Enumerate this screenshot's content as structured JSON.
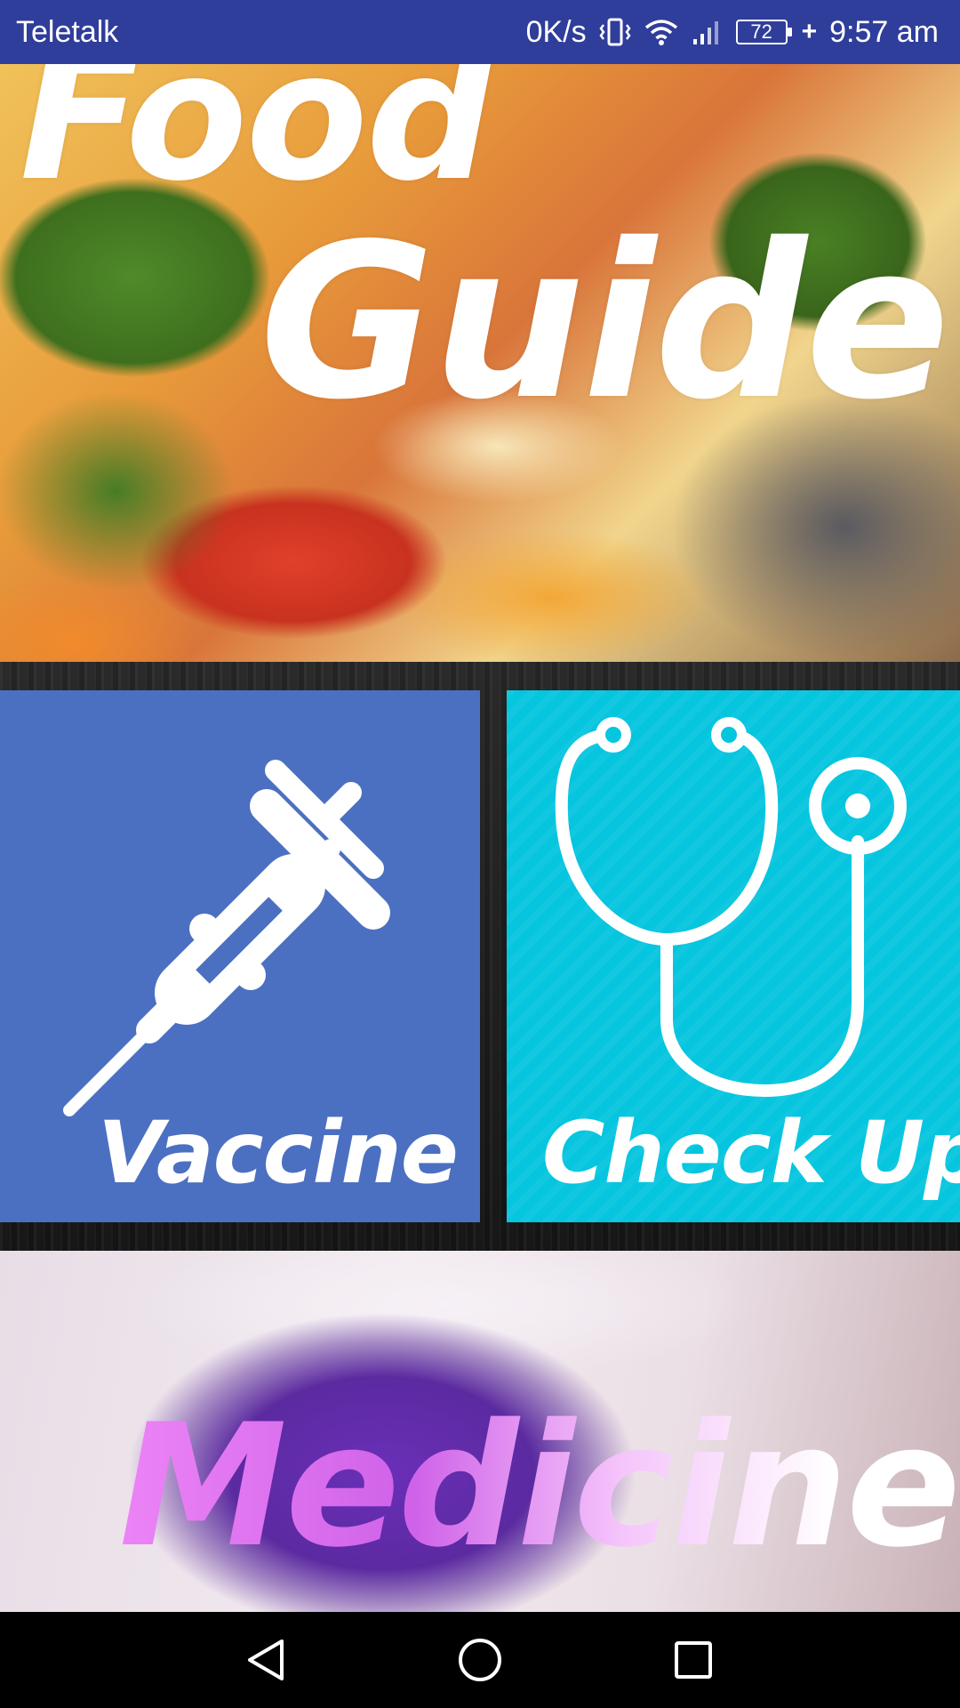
{
  "status_bar": {
    "carrier": "Teletalk",
    "net_speed": "0K/s",
    "battery_level": "72",
    "time": "9:57 am",
    "icons": [
      "vibrate-icon",
      "wifi-icon",
      "signal-icon",
      "battery-icon",
      "charging-icon"
    ]
  },
  "banner": {
    "title_line1": "Food",
    "title_line2": "Guide"
  },
  "tiles": {
    "vaccine": {
      "label": "Vaccine",
      "icon": "syringe-icon",
      "color": "#4b70c1"
    },
    "checkup": {
      "label": "Check Up",
      "icon": "stethoscope-icon",
      "color": "#05c5df"
    }
  },
  "medicine": {
    "label": "Medicine"
  },
  "nav": {
    "icons": [
      "back-icon",
      "home-icon",
      "recents-icon"
    ]
  },
  "colors": {
    "status_bar": "#2f3d9b",
    "nav_bar": "#000000"
  }
}
